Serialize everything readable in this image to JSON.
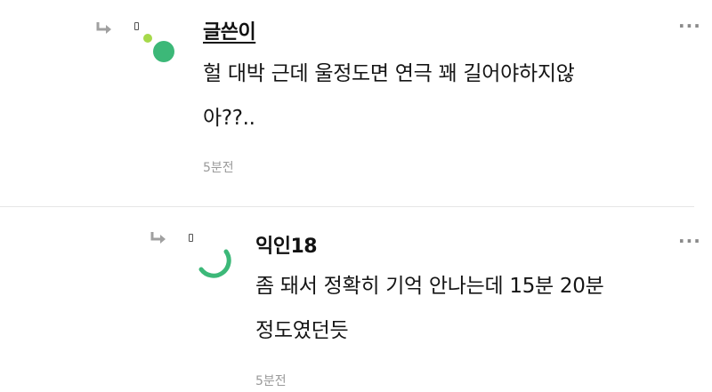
{
  "comments": [
    {
      "username": "글쓴이",
      "text": "헐 대박 근데 울정도면 연극 꽤 길어야하지않\n아??..",
      "time": "5분전",
      "more_icon": "more-dots-icon",
      "avatar_icon": "green-dot-avatar-icon"
    },
    {
      "username": "익인18",
      "text": "좀 돼서 정확히 기억 안나는데 15분 20분\n정도였던듯",
      "time": "5분전",
      "more_icon": "more-dots-icon",
      "avatar_icon": "green-arc-avatar-icon"
    }
  ],
  "colors": {
    "accent_green": "#3cb878",
    "light_green": "#a6d94a",
    "meta_gray": "#9a9a9a"
  }
}
